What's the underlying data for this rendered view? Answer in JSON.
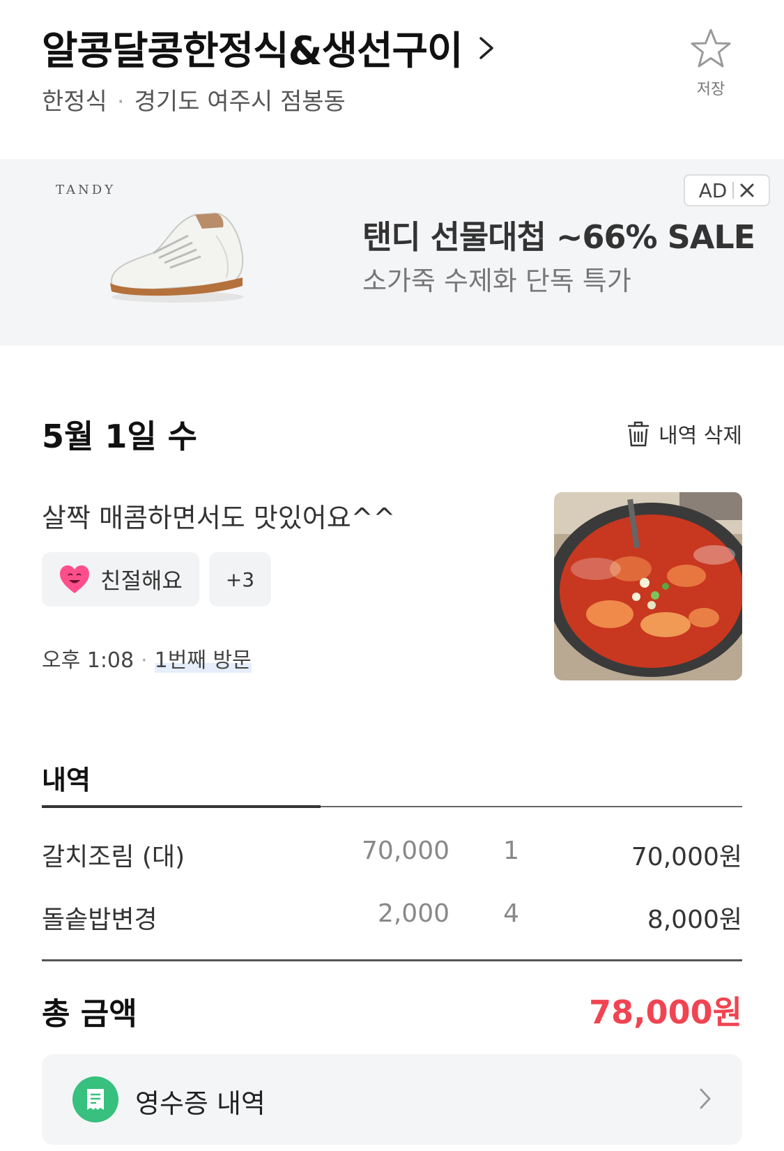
{
  "store": {
    "name": "알콩달콩한정식&생선구이",
    "category": "한정식",
    "location": "경기도 여주시 점봉동",
    "save_label": "저장"
  },
  "ad": {
    "brand": "TANDY",
    "badge": "AD",
    "title": "탠디 선물대첩 ~66% SALE",
    "subtitle": "소가죽 수제화 단독 특가"
  },
  "visit": {
    "date": "5월 1일 수",
    "delete_label": "내역 삭제",
    "review": "살짝 매콤하면서도 맛있어요^^",
    "tag_label": "친절해요",
    "tag_more": "+3",
    "time": "오후 1:08",
    "visit_count": "1번째 방문"
  },
  "history": {
    "title": "내역",
    "items": [
      {
        "name": "갈치조림 (대)",
        "price": "70,000",
        "qty": "1",
        "total": "70,000원"
      },
      {
        "name": "돌솥밥변경",
        "price": "2,000",
        "qty": "4",
        "total": "8,000원"
      }
    ],
    "sum_label": "총 금액",
    "sum_value": "78,000원"
  },
  "receipt": {
    "label": "영수증 내역"
  },
  "colors": {
    "accent_red": "#f04452",
    "receipt_green": "#37c07e"
  }
}
